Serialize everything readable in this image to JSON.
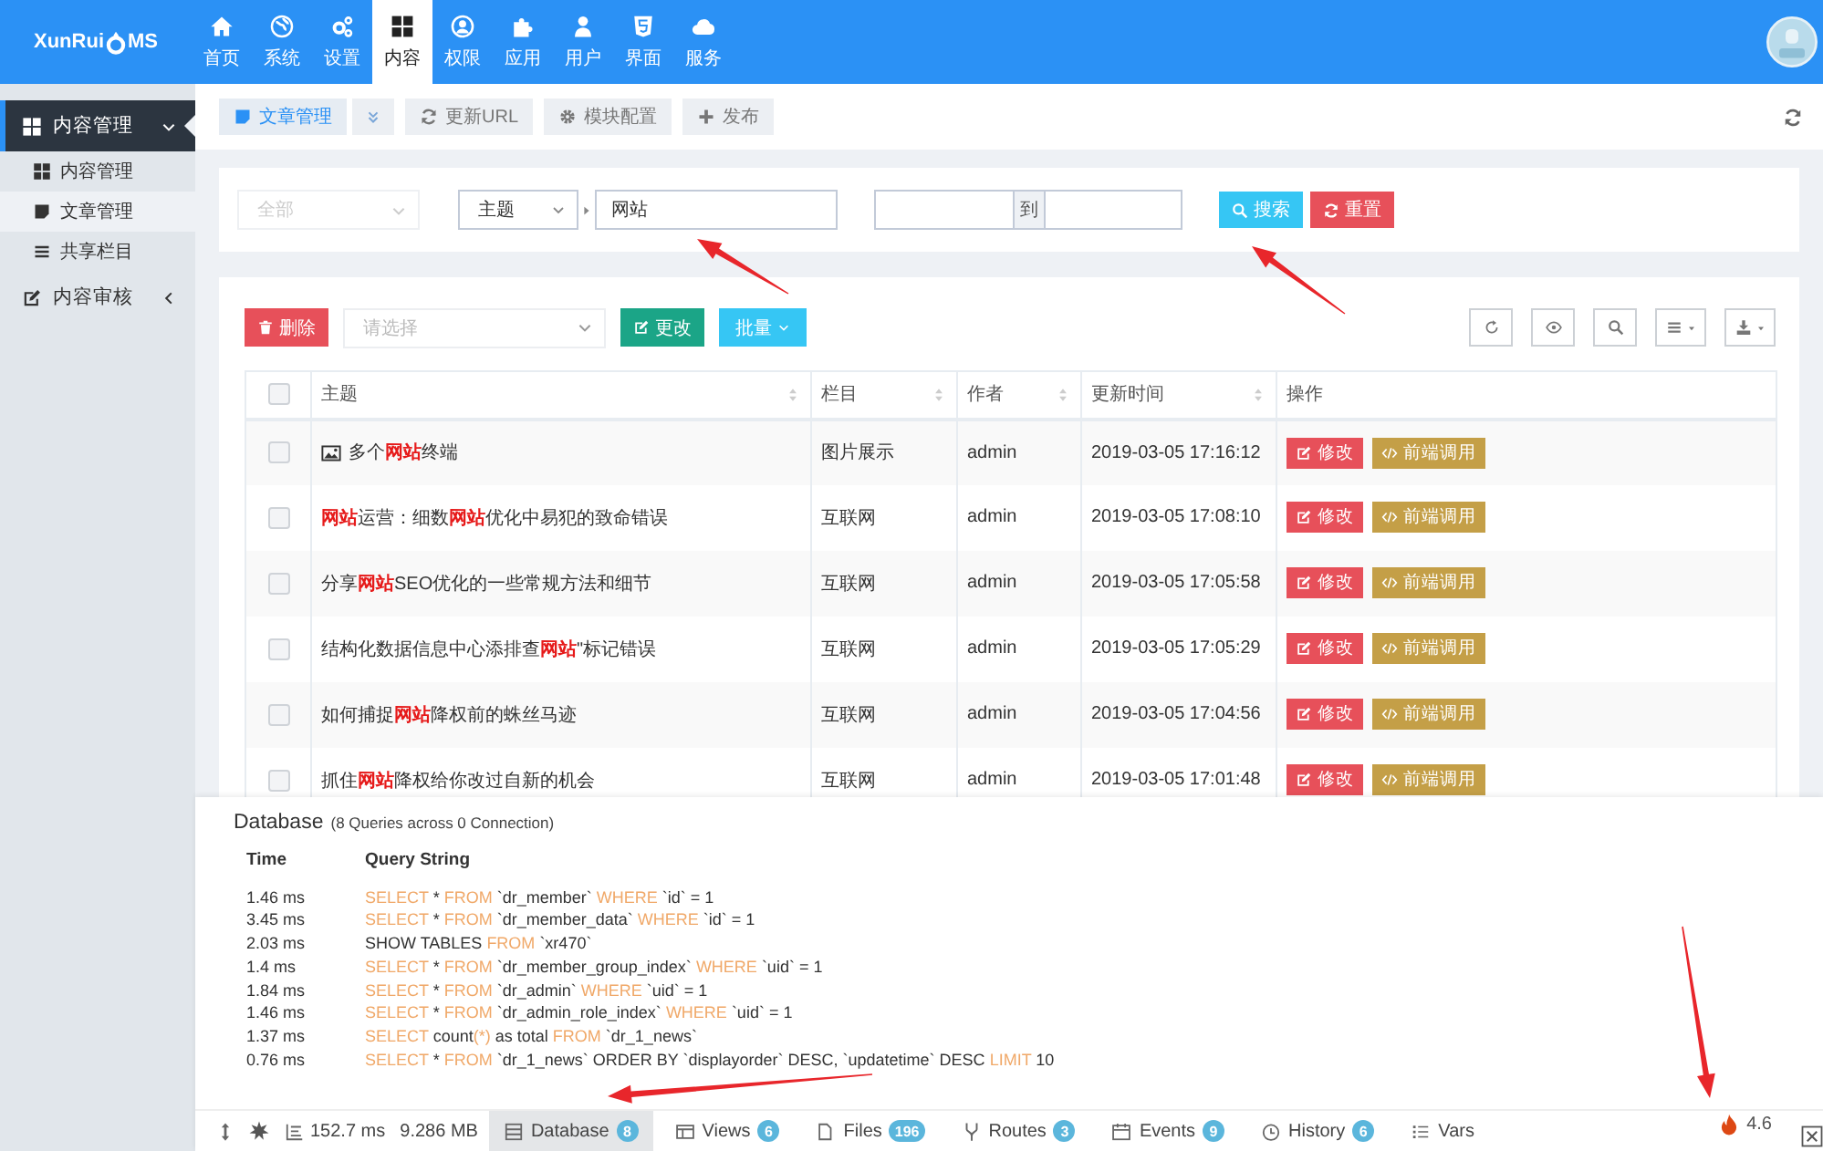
{
  "logo": {
    "text_left": "XunRui",
    "text_right": "MS"
  },
  "nav": [
    {
      "label": "首页",
      "selected": false
    },
    {
      "label": "系统",
      "selected": false
    },
    {
      "label": "设置",
      "selected": false
    },
    {
      "label": "内容",
      "selected": true
    },
    {
      "label": "权限",
      "selected": false
    },
    {
      "label": "应用",
      "selected": false
    },
    {
      "label": "用户",
      "selected": false
    },
    {
      "label": "界面",
      "selected": false
    },
    {
      "label": "服务",
      "selected": false
    }
  ],
  "sidebar": {
    "items": [
      {
        "label": "内容管理",
        "selected": true,
        "expanded": true,
        "children": [
          {
            "label": "内容管理",
            "selected": false
          },
          {
            "label": "文章管理",
            "selected": true
          },
          {
            "label": "共享栏目",
            "selected": false
          }
        ]
      },
      {
        "label": "内容审核",
        "selected": false,
        "expanded": false
      }
    ]
  },
  "toolbar": {
    "tabs": [
      {
        "label": "文章管理",
        "selected": true
      }
    ],
    "actions": [
      {
        "label": "更新URL"
      },
      {
        "label": "模块配置"
      },
      {
        "label": "发布"
      }
    ]
  },
  "search": {
    "scope": {
      "value": "全部",
      "disabled": true
    },
    "field": {
      "value": "主题"
    },
    "keyword": {
      "value": "网站"
    },
    "range_separator": "到",
    "buttons": [
      {
        "kind": "search",
        "label": "搜索"
      },
      {
        "kind": "reset",
        "label": "重置"
      }
    ]
  },
  "table": {
    "bulk_actions": [
      {
        "kind": "delete",
        "label": "删除"
      },
      {
        "kind": "select",
        "placeholder": "请选择"
      },
      {
        "kind": "change",
        "label": "更改"
      },
      {
        "kind": "dropdown",
        "label": "批量"
      }
    ],
    "select_all": {
      "checked": false
    },
    "columns": [
      {
        "label": "主题",
        "sortable": true
      },
      {
        "label": "栏目",
        "sortable": true
      },
      {
        "label": "作者",
        "sortable": true
      },
      {
        "label": "更新时间",
        "sortable": true
      },
      {
        "label": "操作",
        "sortable": false
      }
    ],
    "rows": [
      {
        "checked": false,
        "has_image": true,
        "title": "多个**网站**终端",
        "category": "图片展示",
        "author": "admin",
        "updated": "2019-03-05 17:16:12",
        "actions": [
          "修改",
          "前端调用"
        ]
      },
      {
        "checked": false,
        "has_image": false,
        "title": "**网站**运营：细数**网站**优化中易犯的致命错误",
        "category": "互联网",
        "author": "admin",
        "updated": "2019-03-05 17:08:10",
        "actions": [
          "修改",
          "前端调用"
        ]
      },
      {
        "checked": false,
        "has_image": false,
        "title": "分享**网站**SEO优化的一些常规方法和细节",
        "category": "互联网",
        "author": "admin",
        "updated": "2019-03-05 17:05:58",
        "actions": [
          "修改",
          "前端调用"
        ]
      },
      {
        "checked": false,
        "has_image": false,
        "title": "结构化数据信息中心添排查**网站**\"标记错误",
        "category": "互联网",
        "author": "admin",
        "updated": "2019-03-05 17:05:29",
        "actions": [
          "修改",
          "前端调用"
        ]
      },
      {
        "checked": false,
        "has_image": false,
        "title": "如何捕捉**网站**降权前的蛛丝马迹",
        "category": "互联网",
        "author": "admin",
        "updated": "2019-03-05 17:04:56",
        "actions": [
          "修改",
          "前端调用"
        ]
      },
      {
        "checked": false,
        "has_image": false,
        "title": "抓住**网站**降权给你改过自新的机会",
        "category": "互联网",
        "author": "admin",
        "updated": "2019-03-05 17:01:48",
        "actions": [
          "修改",
          "前端调用"
        ]
      }
    ]
  },
  "debug": {
    "title": "Database",
    "subtitle": "(8 Queries across 0 Connection)",
    "columns": [
      "Time",
      "Query String"
    ],
    "queries": [
      {
        "time": "1.46 ms",
        "query": [
          {
            "kind": "keyword",
            "text": "SELECT"
          },
          {
            "kind": "plain",
            "text": " * "
          },
          {
            "kind": "keyword",
            "text": "FROM"
          },
          {
            "kind": "plain",
            "text": " `dr_member` "
          },
          {
            "kind": "keyword",
            "text": "WHERE"
          },
          {
            "kind": "plain",
            "text": " `id` = 1"
          }
        ]
      },
      {
        "time": "3.45 ms",
        "query": [
          {
            "kind": "keyword",
            "text": "SELECT"
          },
          {
            "kind": "plain",
            "text": " * "
          },
          {
            "kind": "keyword",
            "text": "FROM"
          },
          {
            "kind": "plain",
            "text": " `dr_member_data` "
          },
          {
            "kind": "keyword",
            "text": "WHERE"
          },
          {
            "kind": "plain",
            "text": " `id` = 1"
          }
        ]
      },
      {
        "time": "2.03 ms",
        "query": [
          {
            "kind": "plain",
            "text": "SHOW TABLES "
          },
          {
            "kind": "keyword",
            "text": "FROM"
          },
          {
            "kind": "plain",
            "text": " `xr470`"
          }
        ]
      },
      {
        "time": "1.4 ms",
        "query": [
          {
            "kind": "keyword",
            "text": "SELECT"
          },
          {
            "kind": "plain",
            "text": " * "
          },
          {
            "kind": "keyword",
            "text": "FROM"
          },
          {
            "kind": "plain",
            "text": " `dr_member_group_index` "
          },
          {
            "kind": "keyword",
            "text": "WHERE"
          },
          {
            "kind": "plain",
            "text": " `uid` = 1"
          }
        ]
      },
      {
        "time": "1.84 ms",
        "query": [
          {
            "kind": "keyword",
            "text": "SELECT"
          },
          {
            "kind": "plain",
            "text": " * "
          },
          {
            "kind": "keyword",
            "text": "FROM"
          },
          {
            "kind": "plain",
            "text": " `dr_admin` "
          },
          {
            "kind": "keyword",
            "text": "WHERE"
          },
          {
            "kind": "plain",
            "text": " `uid` = 1"
          }
        ]
      },
      {
        "time": "1.46 ms",
        "query": [
          {
            "kind": "keyword",
            "text": "SELECT"
          },
          {
            "kind": "plain",
            "text": " * "
          },
          {
            "kind": "keyword",
            "text": "FROM"
          },
          {
            "kind": "plain",
            "text": " `dr_admin_role_index` "
          },
          {
            "kind": "keyword",
            "text": "WHERE"
          },
          {
            "kind": "plain",
            "text": " `uid` = 1"
          }
        ]
      },
      {
        "time": "1.37 ms",
        "query": [
          {
            "kind": "keyword",
            "text": "SELECT"
          },
          {
            "kind": "plain",
            "text": " count"
          },
          {
            "kind": "keyword",
            "text": "(*)"
          },
          {
            "kind": "plain",
            "text": " as total "
          },
          {
            "kind": "keyword",
            "text": "FROM"
          },
          {
            "kind": "plain",
            "text": " `dr_1_news`"
          }
        ]
      },
      {
        "time": "0.76 ms",
        "query": [
          {
            "kind": "keyword",
            "text": "SELECT"
          },
          {
            "kind": "plain",
            "text": " * "
          },
          {
            "kind": "keyword",
            "text": "FROM"
          },
          {
            "kind": "plain",
            "text": " `dr_1_news` ORDER BY `displayorder` DESC, `updatetime` DESC "
          },
          {
            "kind": "keyword",
            "text": "LIMIT"
          },
          {
            "kind": "plain",
            "text": " 10"
          }
        ]
      }
    ],
    "stats": [
      "152.7 ms",
      "9.286 MB"
    ],
    "tabs": [
      {
        "label": "Database",
        "badge": "8",
        "selected": true
      },
      {
        "label": "Views",
        "badge": "6",
        "selected": false
      },
      {
        "label": "Files",
        "badge": "196",
        "selected": false
      },
      {
        "label": "Routes",
        "badge": "3",
        "selected": false
      },
      {
        "label": "Events",
        "badge": "9",
        "selected": false
      },
      {
        "label": "History",
        "badge": "6",
        "selected": false
      },
      {
        "label": "Vars",
        "selected": false
      }
    ],
    "version": "4.6"
  }
}
